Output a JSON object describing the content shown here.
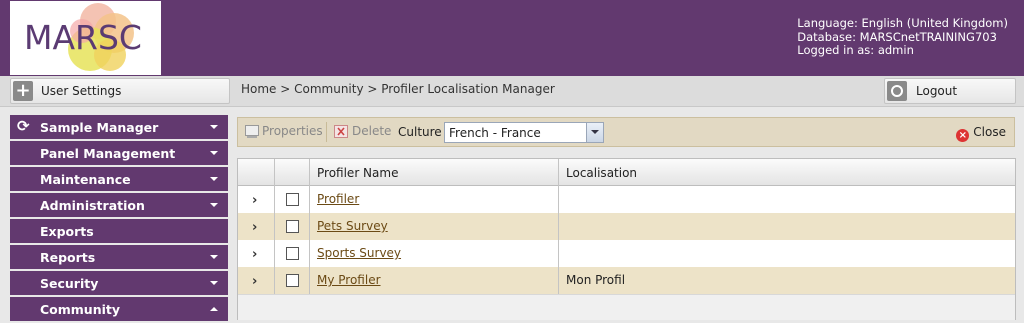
{
  "app": {
    "logo_text": "MARSC"
  },
  "user_info": {
    "language": "Language: English (United Kingdom)",
    "database": "Database: MARSCnetTRAINING703",
    "logged_in": "Logged in as: admin"
  },
  "toolbar": {
    "user_settings_label": "User Settings",
    "breadcrumb": "Home > Community > Profiler Localisation Manager",
    "logout_label": "Logout"
  },
  "sidebar": {
    "items": [
      {
        "label": "Sample Manager",
        "expanded": false
      },
      {
        "label": "Panel Management",
        "expanded": false
      },
      {
        "label": "Maintenance",
        "expanded": false
      },
      {
        "label": "Administration",
        "expanded": false
      },
      {
        "label": "Exports"
      },
      {
        "label": "Reports",
        "expanded": false
      },
      {
        "label": "Security",
        "expanded": false
      },
      {
        "label": "Community",
        "expanded": true
      }
    ]
  },
  "action_bar": {
    "properties_label": "Properties",
    "delete_label": "Delete",
    "culture_label": "Culture",
    "culture_value": "French - France",
    "close_label": "Close"
  },
  "grid": {
    "columns": [
      "Profiler Name",
      "Localisation"
    ],
    "rows": [
      {
        "name": "Profiler",
        "localisation": ""
      },
      {
        "name": "Pets Survey",
        "localisation": ""
      },
      {
        "name": "Sports Survey",
        "localisation": ""
      },
      {
        "name": "My Profiler",
        "localisation": "Mon Profil"
      }
    ]
  },
  "colors": {
    "header_bg": "#62396f",
    "row_alt_bg": "#ede3c8",
    "link": "#6b4a15"
  }
}
